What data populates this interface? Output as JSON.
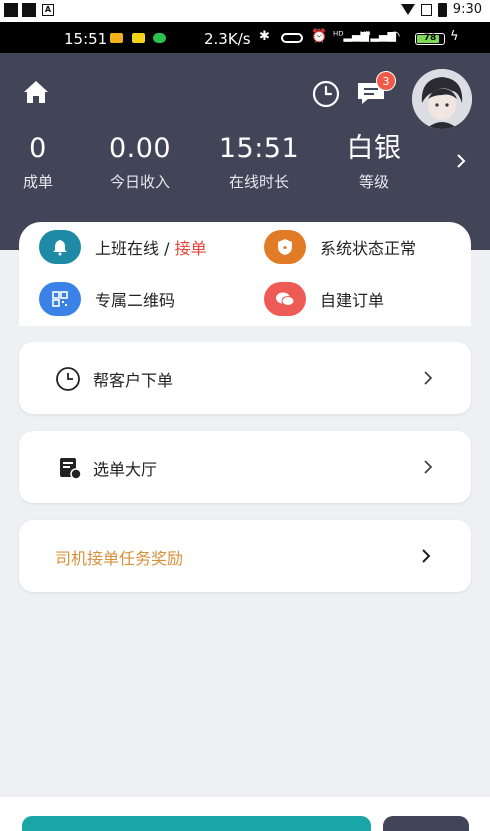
{
  "device_status": {
    "time": "9:30",
    "icons": [
      "wifi-icon",
      "no-sim-icon",
      "battery-icon"
    ]
  },
  "phone_status": {
    "time": "15:51",
    "net_speed": "2.3K/s",
    "battery": "78"
  },
  "header": {
    "message_badge": "3",
    "stats": [
      {
        "value": "0",
        "label": "成单"
      },
      {
        "value": "0.00",
        "label": "今日收入"
      },
      {
        "value": "15:51",
        "label": "在线时长"
      },
      {
        "value": "白银",
        "label": "等级"
      }
    ]
  },
  "quick_actions": [
    {
      "label": "上班在线 / ",
      "highlight": "接单",
      "icon": "bell-icon",
      "color": "#1e8aa6"
    },
    {
      "label": "系统状态正常",
      "icon": "shield-icon",
      "color": "#e17b25"
    },
    {
      "label": "专属二维码",
      "icon": "qrcode-icon",
      "color": "#3b82e6"
    },
    {
      "label": "自建订单",
      "icon": "chat-bubble-icon",
      "color": "#ee5a55"
    }
  ],
  "menu": [
    {
      "label": "帮客户下单",
      "icon": "clock-icon",
      "color": "#222222"
    },
    {
      "label": "选单大厅",
      "icon": "order-hall-icon",
      "color": "#222222"
    },
    {
      "label": "司机接单任务奖励",
      "color": "#d7913a"
    }
  ],
  "colors": {
    "header_bg": "#424458",
    "accent_teal": "#1aa5a6",
    "page_bg": "#eef0f4"
  }
}
